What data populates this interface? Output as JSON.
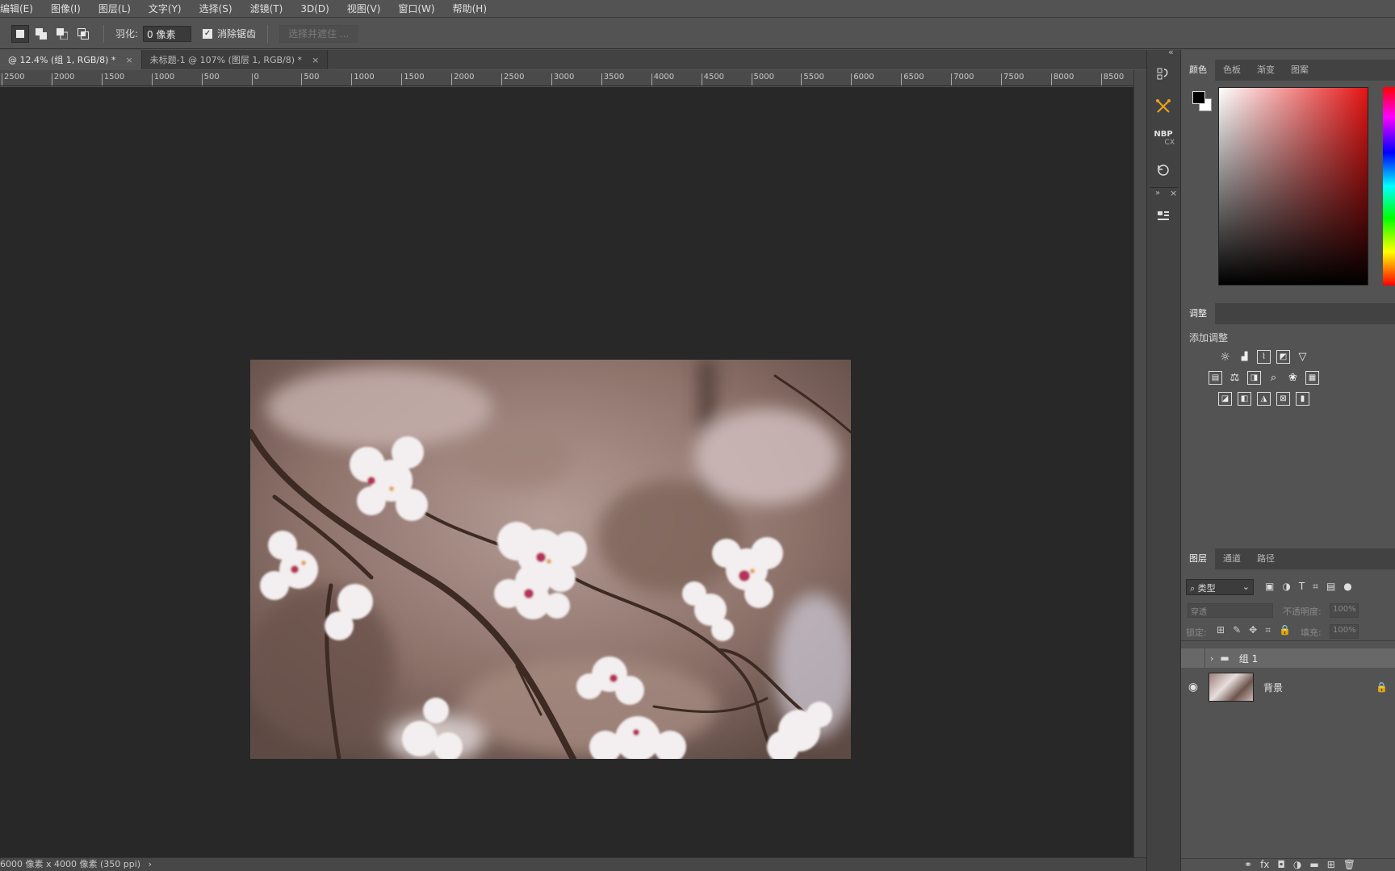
{
  "menu": [
    "编辑(E)",
    "图像(I)",
    "图层(L)",
    "文字(Y)",
    "选择(S)",
    "滤镜(T)",
    "3D(D)",
    "视图(V)",
    "窗口(W)",
    "帮助(H)"
  ],
  "options": {
    "feather_label": "羽化:",
    "feather_value": "0 像素",
    "antialias_label": "消除锯齿",
    "select_mask_label": "选择并遮住 ..."
  },
  "tabs": [
    {
      "label": "@ 12.4% (组 1, RGB/8) *",
      "active": true
    },
    {
      "label": "未标题-1 @ 107% (图层 1, RGB/8) *",
      "active": false
    }
  ],
  "ruler": [
    "2500",
    "2000",
    "1500",
    "1000",
    "500",
    "0",
    "500",
    "1000",
    "1500",
    "2000",
    "2500",
    "3000",
    "3500",
    "4000",
    "4500",
    "5000",
    "5500",
    "6000",
    "6500",
    "7000",
    "7500",
    "8000",
    "8500"
  ],
  "status": {
    "text": "6000 像素 x 4000 像素 (350 ppi)",
    "arrow": "›"
  },
  "toolstrip": {
    "nbp_label": "NBP",
    "cx_label": "CX",
    "collapse": "«",
    "expand": "»",
    "close": "×"
  },
  "color_panel": {
    "tabs": [
      "颜色",
      "色板",
      "渐变",
      "图案"
    ],
    "foreground": "#000000",
    "background": "#ffffff",
    "hue_color": "#e41414"
  },
  "adjustments": {
    "tab": "调整",
    "heading": "添加调整"
  },
  "layers_panel": {
    "tabs": [
      "图层",
      "通道",
      "路径"
    ],
    "filter": "类型",
    "blend_mode": "穿透",
    "opacity_label": "不透明度:",
    "opacity_value": "100%",
    "lock_label": "锁定:",
    "fill_label": "填充:",
    "fill_value": "100%",
    "layers": [
      {
        "name": "组 1",
        "type": "group",
        "visible": false,
        "selected": true
      },
      {
        "name": "背景",
        "type": "image",
        "visible": true,
        "locked": true
      }
    ]
  }
}
